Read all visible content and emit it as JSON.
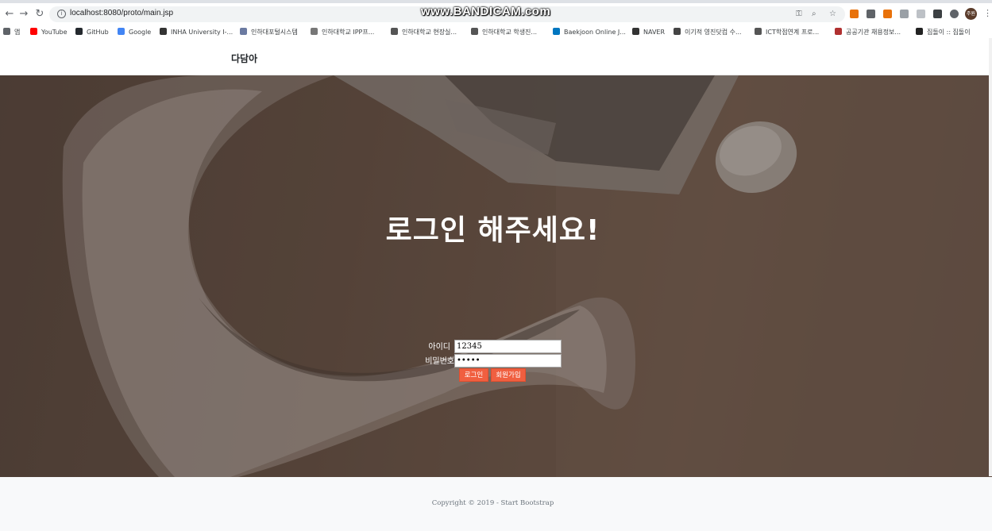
{
  "browser": {
    "url": "localhost:8080/proto/main.jsp",
    "watermark": "www.BANDICAM.com",
    "profile_initials": "주원",
    "bookmarks": [
      {
        "label": "앱",
        "color": "#5f6368"
      },
      {
        "label": "YouTube",
        "color": "#ff0000"
      },
      {
        "label": "GitHub",
        "color": "#24292e"
      },
      {
        "label": "Google",
        "color": "#4285f4"
      },
      {
        "label": "INHA University I-...",
        "color": "#333333"
      },
      {
        "label": "인하대포털시스템",
        "color": "#6b7aa1"
      },
      {
        "label": "인하대학교 IPP프...",
        "color": "#777777"
      },
      {
        "label": "인하대학교 현장실...",
        "color": "#555555"
      },
      {
        "label": "인하대학교 학생진...",
        "color": "#555555"
      },
      {
        "label": "Baekjoon Online J...",
        "color": "#0076c0"
      },
      {
        "label": "NAVER",
        "color": "#333333"
      },
      {
        "label": "이기적 영진닷컴 수...",
        "color": "#444444"
      },
      {
        "label": "ICT학점연계 프로...",
        "color": "#555555"
      },
      {
        "label": "공공기관 채용정보...",
        "color": "#b03030"
      },
      {
        "label": "집돌이 :: 집돌이",
        "color": "#222222"
      }
    ]
  },
  "nav": {
    "brand": "다담아"
  },
  "hero": {
    "title": "로그인 해주세요!"
  },
  "login": {
    "id_label": "아이디",
    "id_value": "12345",
    "pw_label": "비밀번호",
    "pw_value": "•••••",
    "login_button": "로그인",
    "signup_button": "회원가입"
  },
  "footer": {
    "copyright": "Copyright © 2019 - Start Bootstrap"
  },
  "colors": {
    "accent": "#f05f40",
    "hero_overlay": "#5b493e",
    "footer_bg": "#f8f9fa"
  }
}
